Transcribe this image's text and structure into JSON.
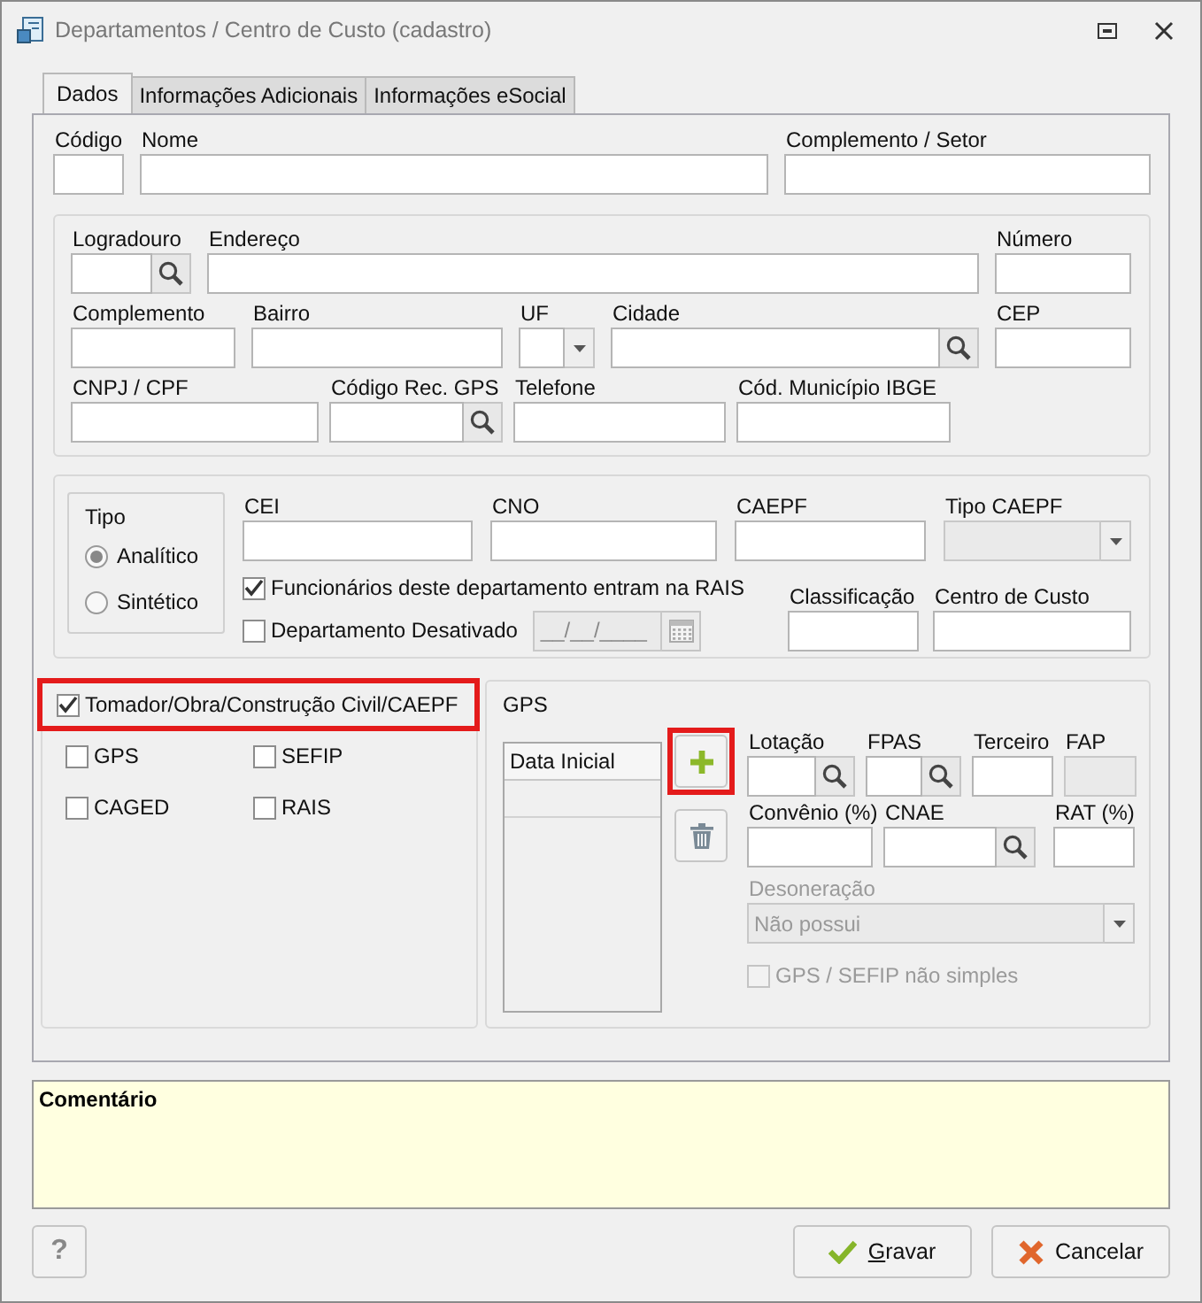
{
  "window": {
    "title": "Departamentos / Centro de Custo (cadastro)"
  },
  "tabs": [
    {
      "label": "Dados",
      "selected": true
    },
    {
      "label": "Informações Adicionais",
      "selected": false
    },
    {
      "label": "Informações eSocial",
      "selected": false
    }
  ],
  "header_fields": [
    {
      "label": "Código",
      "kind": "text"
    },
    {
      "label": "Nome",
      "kind": "text"
    },
    {
      "label": "Complemento / Setor",
      "kind": "text"
    }
  ],
  "address_rows": [
    [
      {
        "label": "Logradouro",
        "kind": "lookup"
      },
      {
        "label": "Endereço",
        "kind": "text"
      },
      {
        "label": "Número",
        "kind": "text"
      }
    ],
    [
      {
        "label": "Complemento",
        "kind": "text"
      },
      {
        "label": "Bairro",
        "kind": "text"
      },
      {
        "label": "UF",
        "kind": "combo"
      },
      {
        "label": "Cidade",
        "kind": "lookup"
      },
      {
        "label": "CEP",
        "kind": "text"
      }
    ],
    [
      {
        "label": "CNPJ / CPF",
        "kind": "text"
      },
      {
        "label": "Código Rec. GPS",
        "kind": "lookup"
      },
      {
        "label": "Telefone",
        "kind": "text"
      },
      {
        "label": "Cód. Município IBGE",
        "kind": "text"
      }
    ]
  ],
  "tipo": {
    "title": "Tipo",
    "options": [
      {
        "label": "Analítico",
        "selected": true
      },
      {
        "label": "Sintético",
        "selected": false
      }
    ]
  },
  "registration_fields": [
    {
      "label": "CEI",
      "kind": "text",
      "disabled": false
    },
    {
      "label": "CNO",
      "kind": "text",
      "disabled": false
    },
    {
      "label": "CAEPF",
      "kind": "text",
      "disabled": false
    },
    {
      "label": "Tipo CAEPF",
      "kind": "combo",
      "disabled": true
    }
  ],
  "rais_checkbox": {
    "label": "Funcionários deste departamento entram na RAIS",
    "checked": true
  },
  "inactive_checkbox": {
    "label": "Departamento Desativado",
    "checked": false
  },
  "inactive_date": {
    "placeholder": "__/__/____",
    "disabled": true
  },
  "class_fields": [
    {
      "label": "Classificação",
      "kind": "text"
    },
    {
      "label": "Centro de Custo",
      "kind": "text"
    }
  ],
  "tomador_checkbox": {
    "label": "Tomador/Obra/Construção Civil/CAEPF",
    "checked": true,
    "highlighted": true
  },
  "obligations": [
    {
      "label": "GPS",
      "checked": false
    },
    {
      "label": "SEFIP",
      "checked": false
    },
    {
      "label": "CAGED",
      "checked": false
    },
    {
      "label": "RAIS",
      "checked": false
    }
  ],
  "gps": {
    "title": "GPS",
    "list_columns": [
      "Data Inicial"
    ],
    "add_highlighted": true
  },
  "gps_rows": [
    [
      {
        "label": "Lotação",
        "kind": "lookup",
        "disabled": false
      },
      {
        "label": "FPAS",
        "kind": "lookup",
        "disabled": false
      },
      {
        "label": "Terceiro",
        "kind": "text",
        "disabled": false
      },
      {
        "label": "FAP",
        "kind": "text",
        "disabled": true
      }
    ],
    [
      {
        "label": "Convênio (%)",
        "kind": "text",
        "disabled": false
      },
      {
        "label": "CNAE",
        "kind": "lookup",
        "disabled": false
      },
      {
        "label": "RAT (%)",
        "kind": "text",
        "disabled": false
      }
    ]
  ],
  "desoneracao": {
    "label": "Desoneração",
    "value": "Não possui",
    "disabled": true
  },
  "simple_checkbox": {
    "label": "GPS / SEFIP não simples",
    "checked": false,
    "disabled": true
  },
  "comment": {
    "value": "Comentário"
  },
  "help_button": {
    "label": "?"
  },
  "buttons": [
    {
      "label": "Gravar",
      "kind": "save",
      "first_letter_underlined": true
    },
    {
      "label": "Cancelar",
      "kind": "cancel"
    }
  ]
}
